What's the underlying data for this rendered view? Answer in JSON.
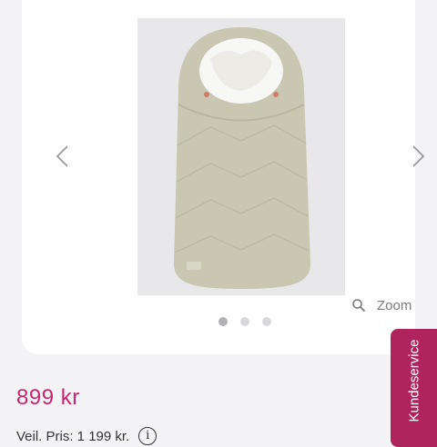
{
  "gallery": {
    "image_alt": "beige footmuff",
    "prev_icon": "chevron-left-icon",
    "next_icon": "chevron-right-icon",
    "zoom_label": "Zoom",
    "zoom_icon": "magnifier-icon",
    "dot_count": 3,
    "active_dot": 1
  },
  "product": {
    "price": "899 kr",
    "old_price_label": "Veil. Pris: 1 199 kr.",
    "info_symbol": "i"
  },
  "support_tab": {
    "label": "Kundeservice",
    "color": "#b0245e"
  },
  "colors": {
    "price": "#c7266e",
    "footmuff": "#c9c7b1"
  }
}
